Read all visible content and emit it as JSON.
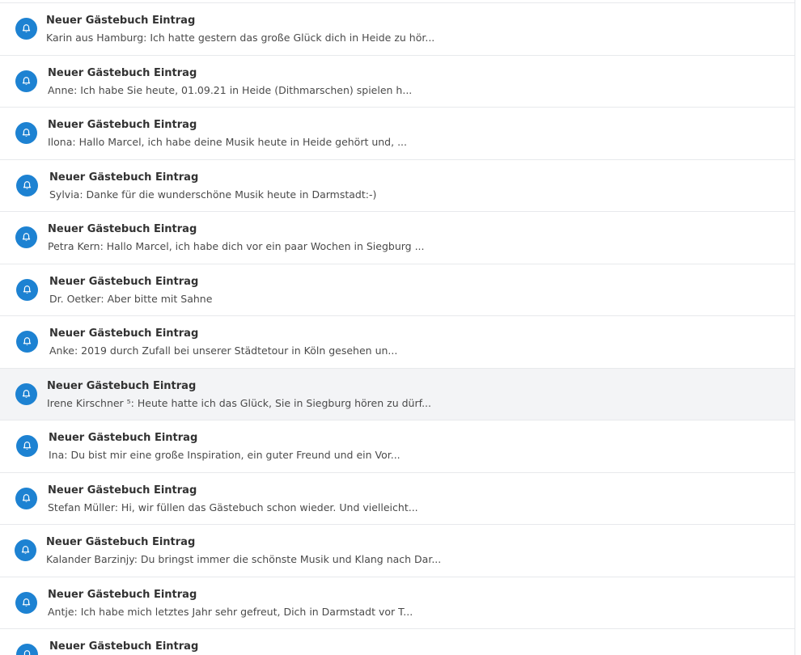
{
  "notifications": [
    {
      "title": "Neuer Gästebuch Eintrag",
      "snippet": "Karin aus Hamburg: Ich hatte gestern das große Glück dich in Heide zu hör..."
    },
    {
      "title": "Neuer Gästebuch Eintrag",
      "snippet": "Anne: Ich habe Sie heute, 01.09.21 in Heide (Dithmarschen) spielen h..."
    },
    {
      "title": "Neuer Gästebuch Eintrag",
      "snippet": "Ilona: Hallo Marcel, ich habe deine Musik heute in Heide gehört und, ..."
    },
    {
      "title": "Neuer Gästebuch Eintrag",
      "snippet": "Sylvia: Danke für die wunderschöne Musik heute in Darmstadt:-)"
    },
    {
      "title": "Neuer Gästebuch Eintrag",
      "snippet": "Petra Kern: Hallo Marcel, ich habe dich vor ein paar Wochen in Siegburg ..."
    },
    {
      "title": "Neuer Gästebuch Eintrag",
      "snippet": "Dr. Oetker: Aber bitte mit Sahne"
    },
    {
      "title": "Neuer Gästebuch Eintrag",
      "snippet": "Anke: 2019 durch Zufall bei unserer Städtetour in Köln gesehen un..."
    },
    {
      "title": "Neuer Gästebuch Eintrag",
      "snippet": "Irene Kirschner ⁵: Heute hatte ich das Glück, Sie in Siegburg hören zu dürf..."
    },
    {
      "title": "Neuer Gästebuch Eintrag",
      "snippet": "Ina: Du bist mir eine große Inspiration, ein guter Freund und ein Vor..."
    },
    {
      "title": "Neuer Gästebuch Eintrag",
      "snippet": "Stefan Müller: Hi, wir füllen das Gästebuch schon wieder. Und vielleicht..."
    },
    {
      "title": "Neuer Gästebuch Eintrag",
      "snippet": "Kalander Barzinjy: Du bringst immer die schönste Musik und Klang nach Dar..."
    },
    {
      "title": "Neuer Gästebuch Eintrag",
      "snippet": "Antje: Ich habe mich letztes Jahr sehr gefreut, Dich in Darmstadt vor T..."
    },
    {
      "title": "Neuer Gästebuch Eintrag",
      "snippet": ""
    }
  ],
  "colors": {
    "icon_bg": "#1d82d2",
    "row_highlight": "#f3f4f6"
  },
  "icon": "bell-icon"
}
